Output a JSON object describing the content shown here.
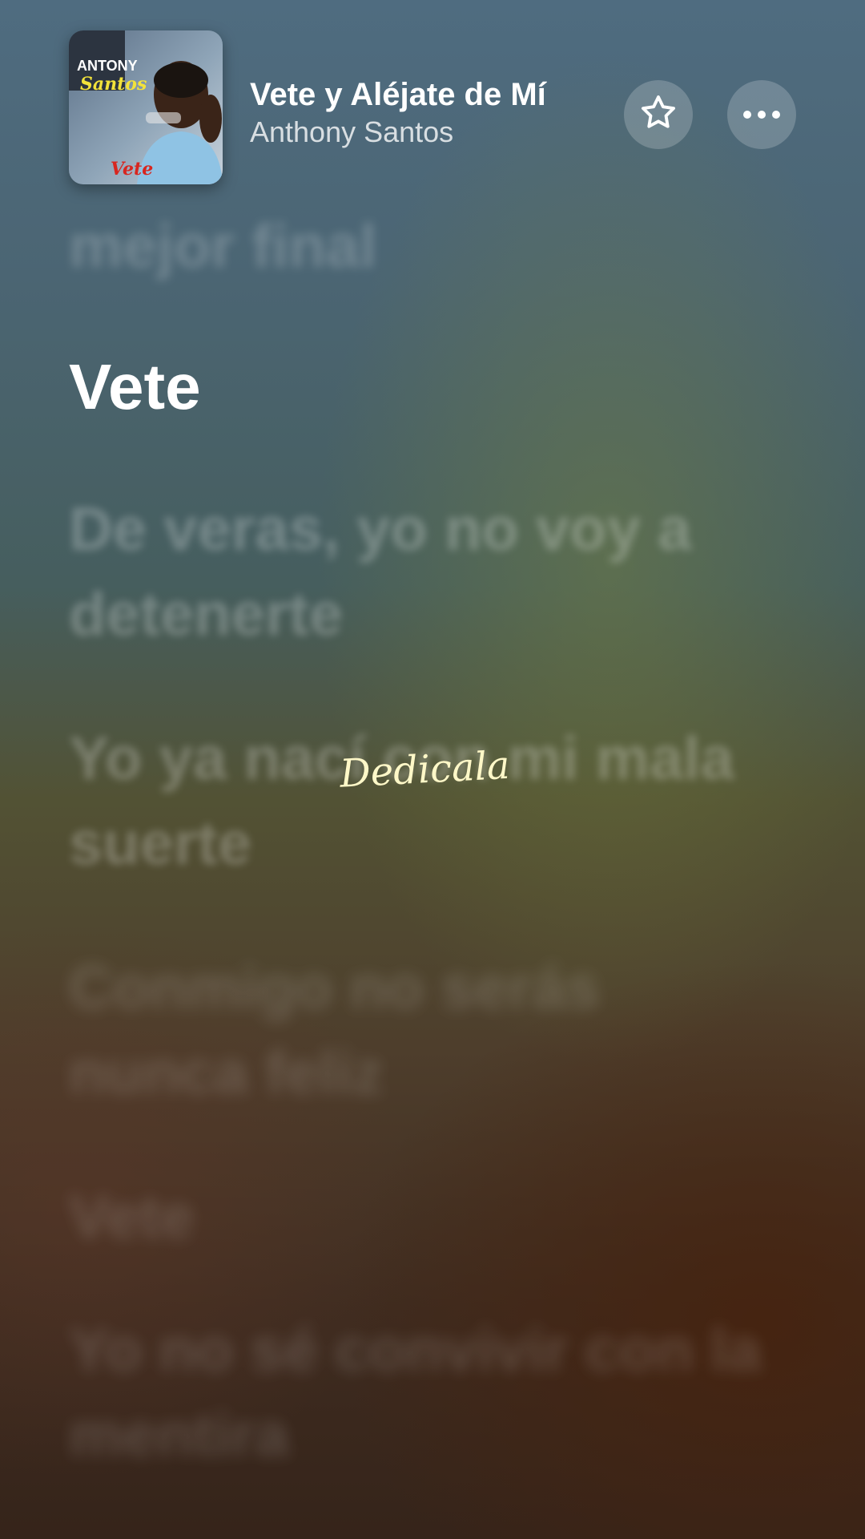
{
  "track": {
    "title": "Vete y Aléjate de Mí",
    "artist": "Anthony Santos",
    "album_art": {
      "text_top": "ANTONY",
      "text_mid": "Santos",
      "text_bottom": "Vete"
    }
  },
  "actions": {
    "favorite_icon": "star-outline-icon",
    "more_icon": "ellipsis-icon"
  },
  "lyrics": [
    {
      "text": "mejor final",
      "state": "past"
    },
    {
      "text": "Vete",
      "state": "active"
    },
    {
      "text": "De veras, yo no voy a detenerte",
      "state": "upcoming"
    },
    {
      "text": "Yo ya nací con mi mala suerte",
      "state": "upcoming"
    },
    {
      "text": "Conmigo no serás nunca feliz",
      "state": "upcoming"
    },
    {
      "text": "Vete",
      "state": "upcoming"
    },
    {
      "text": "Yo no sé convivir con la mentira",
      "state": "upcoming"
    }
  ],
  "watermark": {
    "text": "Dedicala"
  },
  "colors": {
    "active_lyric": "#ffffff",
    "watermark": "#fff8c8"
  }
}
